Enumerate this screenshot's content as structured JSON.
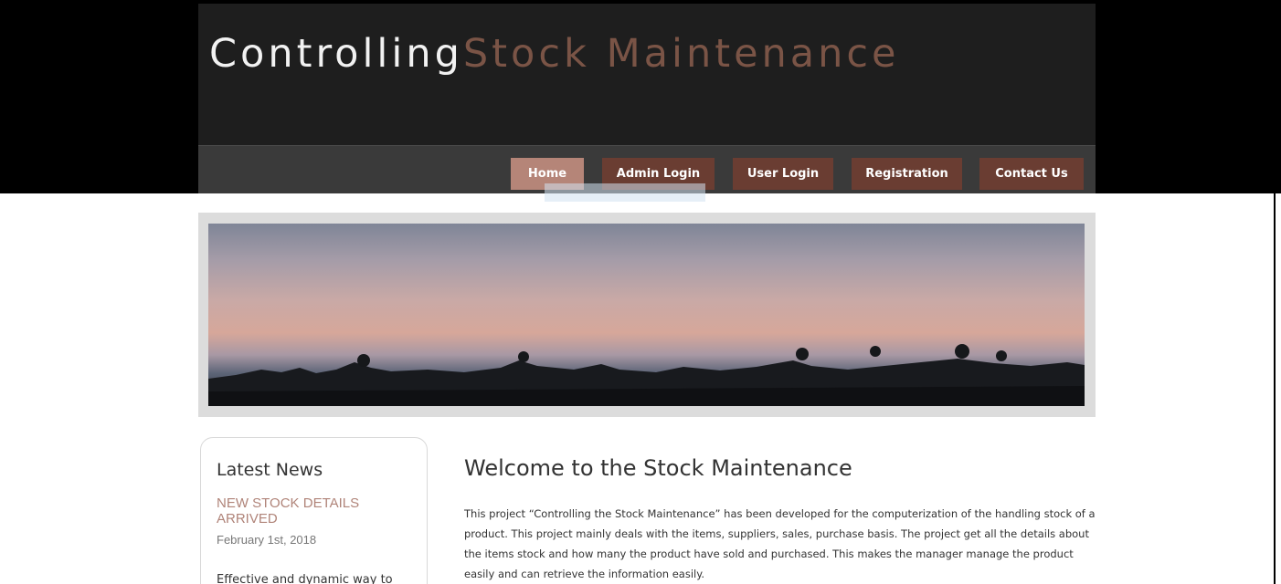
{
  "site": {
    "logo_part1": "Controlling",
    "logo_part2": "Stock Maintenance"
  },
  "nav": {
    "items": [
      {
        "label": "Home",
        "active": true
      },
      {
        "label": "Admin Login"
      },
      {
        "label": "User Login"
      },
      {
        "label": "Registration"
      },
      {
        "label": "Contact Us"
      }
    ]
  },
  "sidebar": {
    "title": "Latest News",
    "news": [
      {
        "headline": "NEW STOCK DETAILS ARRIVED",
        "date": "February 1st, 2018",
        "text": "Effective and dynamic way to"
      }
    ]
  },
  "main": {
    "title": "Welcome to the Stock Maintenance",
    "body": "This project “Controlling the Stock Maintenance” has been developed for the computerization of the handling stock of a product. This project mainly deals with the items, suppliers, sales, purchase basis. The project get all the details about the items stock and how many the product have sold and purchased. This makes the manager manage the product easily and can retrieve the information easily."
  },
  "colors": {
    "nav_button": "#6a3d32",
    "nav_button_active": "#b58578",
    "logo_accent": "#7a5446",
    "news_headline": "#b08479"
  }
}
